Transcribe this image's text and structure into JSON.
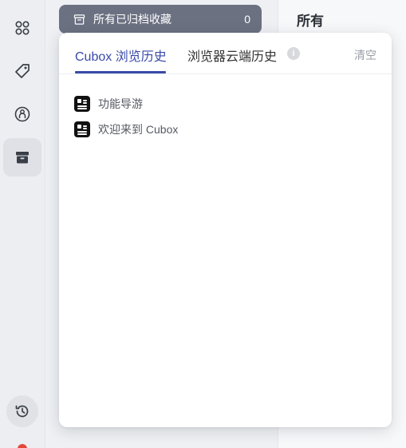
{
  "archive_bar": {
    "label": "所有已归档收藏",
    "count": "0"
  },
  "right_column": {
    "title": "所有"
  },
  "history_panel": {
    "tabs": [
      {
        "label": "Cubox 浏览历史",
        "active": true
      },
      {
        "label": "浏览器云端历史",
        "active": false
      }
    ],
    "info_icon": "i",
    "clear_label": "清空",
    "items": [
      {
        "title": "功能导游",
        "icon": "doc-icon"
      },
      {
        "title": "欢迎来到 Cubox",
        "icon": "doc-icon"
      }
    ]
  },
  "rail": {
    "icons": [
      "grid-icon",
      "tag-icon",
      "person-icon",
      "archive-icon"
    ],
    "bottom_icon": "history-icon"
  },
  "colors": {
    "accent": "#3a4aa8",
    "archive_bar": "#6b7181",
    "status_dot": "#e2473b"
  }
}
